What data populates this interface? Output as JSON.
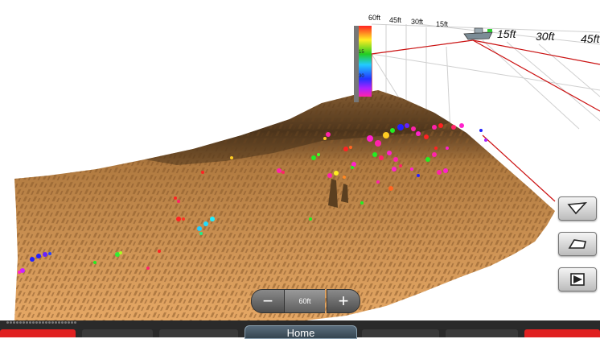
{
  "depth_scale": {
    "top_labels": [
      "60ft",
      "45ft",
      "30ft",
      "15ft"
    ],
    "range_labels": [
      "15ft",
      "30ft",
      "45ft"
    ],
    "colorbar_ticks": [
      "15",
      "30"
    ]
  },
  "zoom": {
    "minus_symbol": "−",
    "value": "60ft",
    "plus_symbol": "+"
  },
  "view_buttons": [
    {
      "name": "front-view",
      "icon": "tilted-plane-icon"
    },
    {
      "name": "side-view",
      "icon": "flat-plane-icon"
    },
    {
      "name": "back-view",
      "icon": "play-arrow-icon"
    }
  ],
  "bottom_bar": {
    "home_label": "Home",
    "softkey_colors": [
      "#e02020",
      "#3a3a3a",
      "#3a3a3a",
      "#3a3a3a",
      "#3a3a3a",
      "#e02020"
    ]
  },
  "colors": {
    "bottom_terrain": "#d8924e",
    "terrain_dark": "#6b4a26",
    "frame_line": "#cc1111"
  }
}
